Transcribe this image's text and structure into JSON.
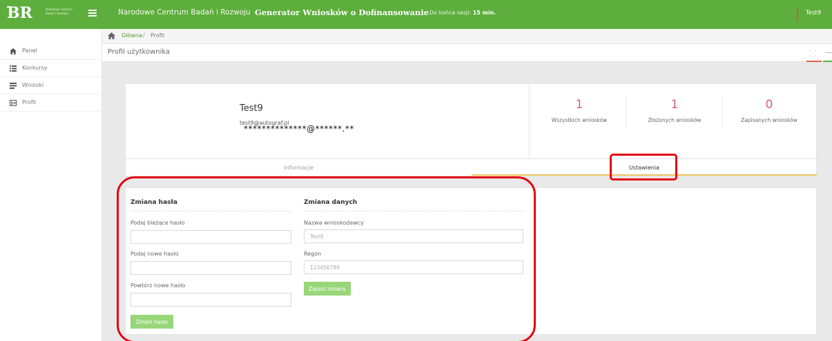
{
  "topbar": {
    "logo_lines": [
      "Narodowe Centrum",
      "Badań i Rozwoju"
    ],
    "org_name": "Narodowe Centrum Badań i Rozwoju",
    "app_title": "Generator Wniosków o Dofinansowanie",
    "session_label": "Do końca sesji:",
    "session_value": "15 min.",
    "user": "Test9",
    "colors": {
      "bar": "#5dae3c",
      "accent_red": "#d9534f"
    }
  },
  "breadcrumb": {
    "home": "Główna",
    "separator": "/",
    "current": "Profil"
  },
  "sidebar": {
    "items": [
      {
        "icon": "home-icon",
        "label": "Panel"
      },
      {
        "icon": "list-icon",
        "label": "Konkursy"
      },
      {
        "icon": "document-list-icon",
        "label": "Wnioski"
      },
      {
        "icon": "profile-card-icon",
        "label": "Profil"
      }
    ]
  },
  "page": {
    "title": "Profil użytkownika"
  },
  "profile": {
    "name": "Test9",
    "email": "test9@autograf.pl",
    "email_mask": "**************@******.**",
    "stats": [
      {
        "value": "1",
        "label": "Wszystkich wniosków"
      },
      {
        "value": "1",
        "label": "Złożonych wniosków"
      },
      {
        "value": "0",
        "label": "Zapisanych wniosków"
      }
    ],
    "stat_color": "#d4607c"
  },
  "tabs": [
    {
      "label": "Informacje",
      "active": false
    },
    {
      "label": "Ustawienia",
      "active": true
    }
  ],
  "password_form": {
    "title": "Zmiana hasła",
    "current_label": "Podaj bieżące hasło",
    "current_value": "",
    "new_label": "Podaj nowe hasło",
    "new_value": "",
    "repeat_label": "Powtórz nowe hasło",
    "repeat_value": "",
    "submit": "Zmień hasło"
  },
  "data_form": {
    "title": "Zmiana danych",
    "name_label": "Nazwa wnioskodawcy",
    "name_value": "Test9",
    "regon_label": "Regon",
    "regon_value": "123456789",
    "submit": "Zapisz zmiany"
  },
  "annotation_color": "#e3000f"
}
